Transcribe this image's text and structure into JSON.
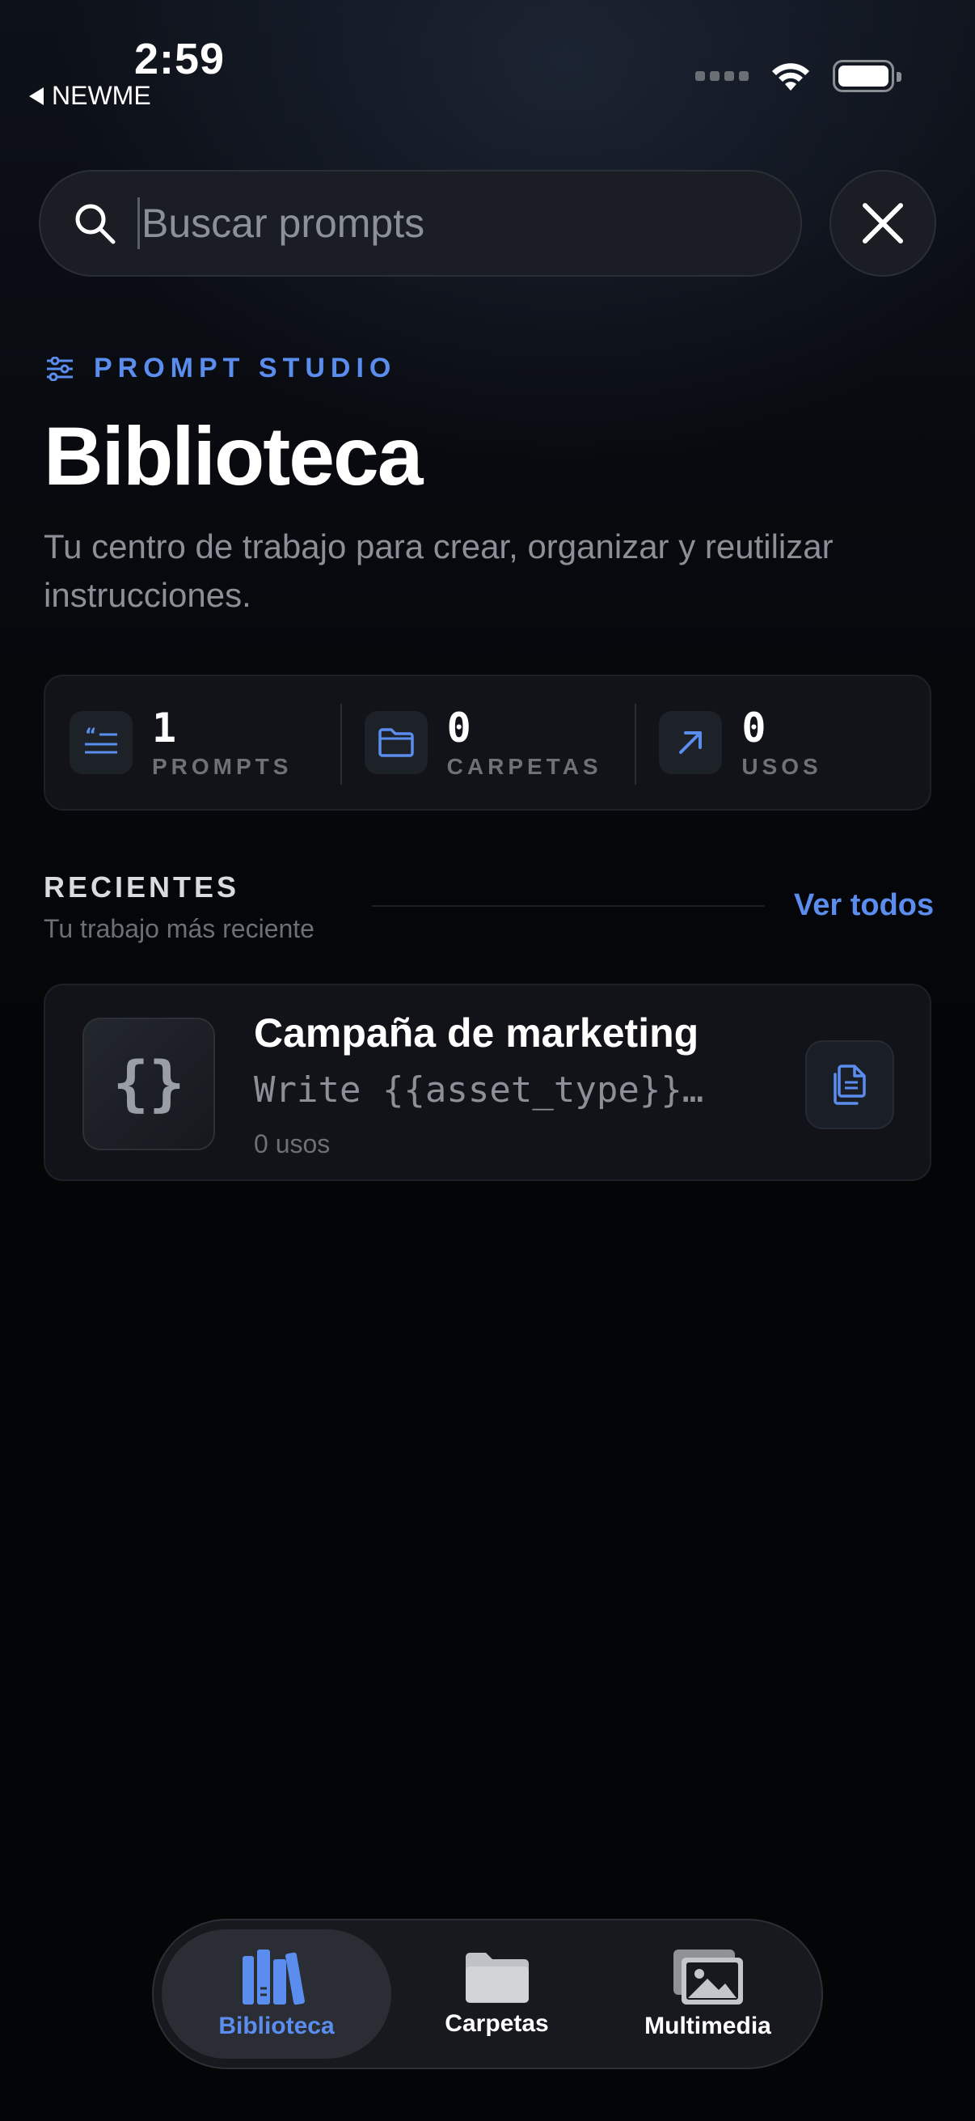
{
  "status_bar": {
    "time": "2:59",
    "back_label": "NEWME"
  },
  "search": {
    "placeholder": "Buscar prompts",
    "value": ""
  },
  "header": {
    "eyebrow": "PROMPT STUDIO",
    "title": "Biblioteca",
    "subtitle": "Tu centro de trabajo para crear, organizar y reutilizar instrucciones."
  },
  "stats": [
    {
      "value": "1",
      "label": "PROMPTS",
      "icon": "quote-list-icon"
    },
    {
      "value": "0",
      "label": "CARPETAS",
      "icon": "folder-icon"
    },
    {
      "value": "0",
      "label": "USOS",
      "icon": "arrow-up-right-icon"
    }
  ],
  "recent": {
    "title": "RECIENTES",
    "subtitle": "Tu trabajo más reciente",
    "see_all": "Ver todos",
    "items": [
      {
        "title": "Campaña de marketing",
        "preview": "Write {{asset_type}}…",
        "meta": "0 usos",
        "thumb_glyph": "{}"
      }
    ]
  },
  "tabs": [
    {
      "label": "Biblioteca",
      "icon": "books-icon",
      "active": true
    },
    {
      "label": "Carpetas",
      "icon": "folder-icon",
      "active": false
    },
    {
      "label": "Multimedia",
      "icon": "photos-icon",
      "active": false
    }
  ],
  "colors": {
    "accent": "#5b8def",
    "background": "#040507",
    "card": "#111318"
  }
}
